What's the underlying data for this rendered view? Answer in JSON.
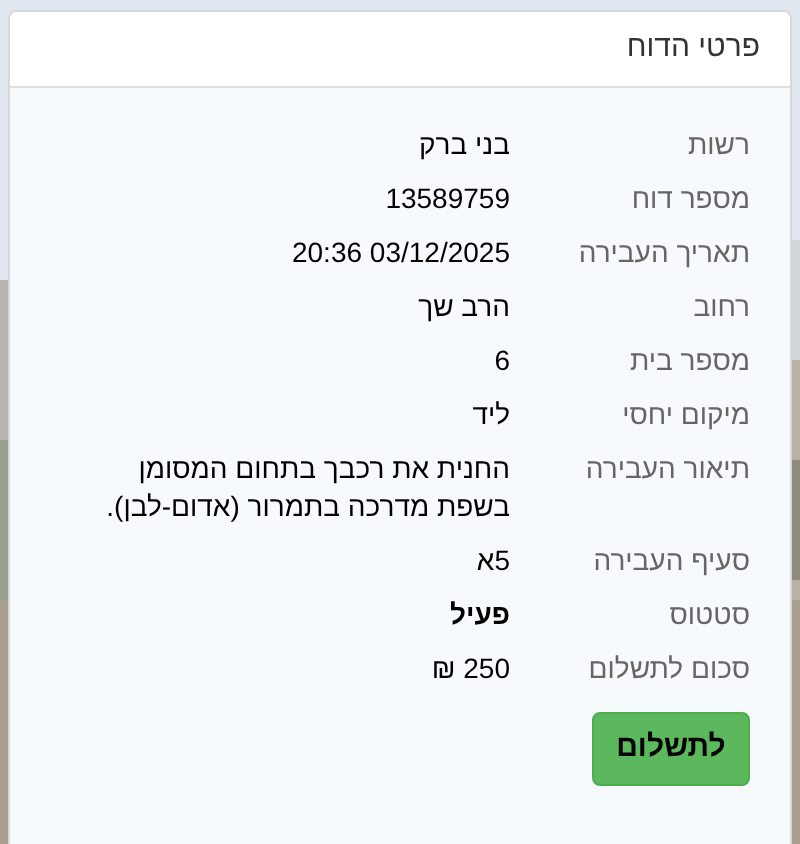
{
  "card": {
    "title": "פרטי הדוח"
  },
  "rows": [
    {
      "label": "רשות",
      "value": "בני ברק",
      "bold": false
    },
    {
      "label": "מספר דוח",
      "value": "13589759",
      "bold": false
    },
    {
      "label": "תאריך העבירה",
      "value": "03/12/2025 20:36",
      "bold": false
    },
    {
      "label": "רחוב",
      "value": "הרב שך",
      "bold": false
    },
    {
      "label": "מספר בית",
      "value": "6",
      "bold": false
    },
    {
      "label": "מיקום יחסי",
      "value": "ליד",
      "bold": false
    },
    {
      "label": "תיאור העבירה",
      "value": "החנית את רכבך בתחום המסומן בשפת מדרכה בתמרור (אדום-לבן).",
      "bold": false
    },
    {
      "label": "סעיף העבירה",
      "value": "5א",
      "bold": false
    },
    {
      "label": "סטטוס",
      "value": "פעיל",
      "bold": true
    },
    {
      "label": "סכום לתשלום",
      "value": "250 ₪",
      "bold": false
    }
  ],
  "pay_button": {
    "label": "לתשלום"
  }
}
